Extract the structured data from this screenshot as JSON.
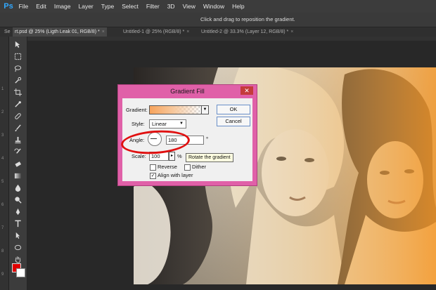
{
  "app": {
    "logo": "Ps"
  },
  "menu": [
    "File",
    "Edit",
    "Image",
    "Layer",
    "Type",
    "Select",
    "Filter",
    "3D",
    "View",
    "Window",
    "Help"
  ],
  "options_bar": {
    "hint": "Click and drag to reposition the gradient."
  },
  "doc_tabs": [
    {
      "label": "Se",
      "active": false
    },
    {
      "label": "rt.psd @ 25% (Ligth Leak 01, RGB/8) *",
      "active": true
    },
    {
      "label": "Untitled-1 @ 25% (RGB/8) *",
      "active": false
    },
    {
      "label": "Untitled-2 @ 33.3% (Layer 12, RGB/8) *",
      "active": false
    }
  ],
  "ruler_numbers": [
    "1",
    "2",
    "3",
    "4",
    "5",
    "6",
    "7",
    "8",
    "9"
  ],
  "colors": {
    "foreground": "#e00000",
    "background": "#ffffff",
    "dialog_frame": "#e060a8",
    "annotation": "#e01010"
  },
  "dialog": {
    "title": "Gradient Fill",
    "close_glyph": "✕",
    "gradient_label": "Gradient:",
    "style_label": "Style:",
    "style_value": "Linear",
    "angle_label": "Angle:",
    "angle_value": "180",
    "angle_unit": "°",
    "scale_label": "Scale:",
    "scale_value": "100",
    "scale_unit": "%",
    "reverse_label": "Reverse",
    "dither_label": "Dither",
    "align_label": "Align with layer",
    "reverse_checked": false,
    "dither_checked": false,
    "align_checked": true,
    "ok_label": "OK",
    "cancel_label": "Cancel"
  },
  "tooltip": "Rotate the gradient",
  "tools": [
    "move-icon",
    "marquee-icon",
    "lasso-icon",
    "quick-select-icon",
    "crop-icon",
    "eyedropper-icon",
    "healing-icon",
    "brush-icon",
    "clone-stamp-icon",
    "history-brush-icon",
    "eraser-icon",
    "gradient-icon",
    "blur-icon",
    "dodge-icon",
    "pen-icon",
    "type-icon",
    "path-select-icon",
    "shape-icon",
    "hand-icon",
    "zoom-icon"
  ]
}
